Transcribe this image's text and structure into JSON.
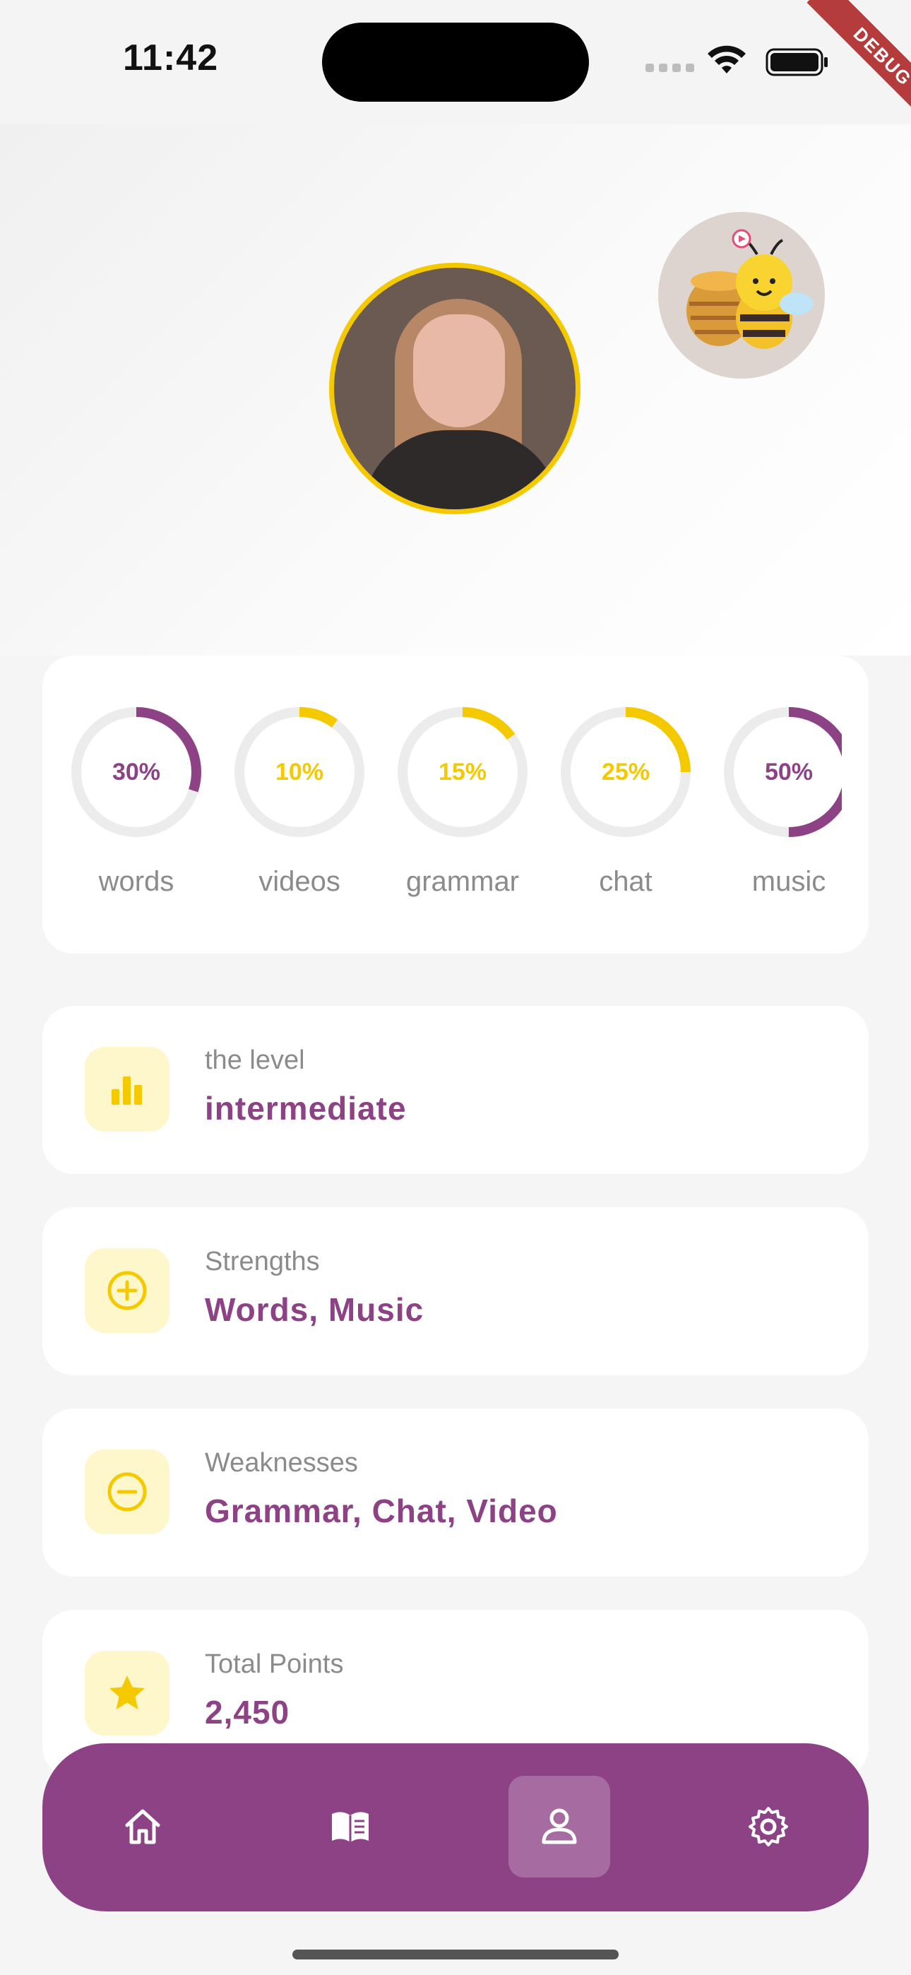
{
  "status_bar": {
    "time": "11:42"
  },
  "debug_banner": {
    "label": "DEBUG"
  },
  "colors": {
    "accent_purple": "#8d4286",
    "accent_yellow": "#f5c900",
    "icon_bg": "#fff7cc"
  },
  "progress": [
    {
      "label": "words",
      "percent_text": "30%",
      "value": 30,
      "color": "#8d4286"
    },
    {
      "label": "videos",
      "percent_text": "10%",
      "value": 10,
      "color": "#f5c900"
    },
    {
      "label": "grammar",
      "percent_text": "15%",
      "value": 15,
      "color": "#f5c900"
    },
    {
      "label": "chat",
      "percent_text": "25%",
      "value": 25,
      "color": "#f5c900"
    },
    {
      "label": "music",
      "percent_text": "50%",
      "value": 50,
      "color": "#8d4286"
    }
  ],
  "info_cards": [
    {
      "icon": "bar-chart-icon",
      "label": "the level",
      "value": "intermediate"
    },
    {
      "icon": "plus-circle-icon",
      "label": "Strengths",
      "value": "Words, Music"
    },
    {
      "icon": "minus-circle-icon",
      "label": "Weaknesses",
      "value": "Grammar, Chat, Video"
    },
    {
      "icon": "star-icon",
      "label": "Total Points",
      "value": "2,450"
    }
  ],
  "bottom_nav": {
    "items": [
      {
        "icon": "home-icon",
        "active": false
      },
      {
        "icon": "book-icon",
        "active": false
      },
      {
        "icon": "person-icon",
        "active": true
      },
      {
        "icon": "settings-icon",
        "active": false
      }
    ]
  }
}
